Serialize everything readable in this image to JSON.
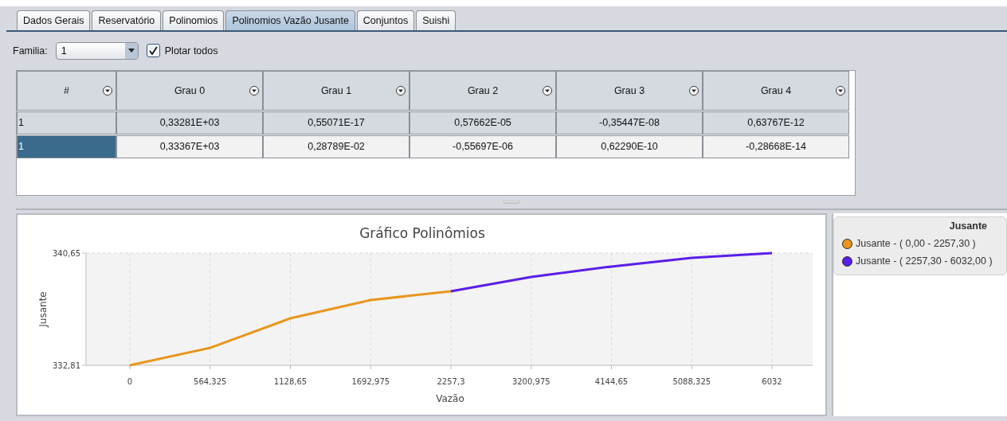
{
  "tabs": [
    {
      "label": "Dados Gerais",
      "selected": false
    },
    {
      "label": "Reservatório",
      "selected": false
    },
    {
      "label": "Polinomios",
      "selected": false
    },
    {
      "label": "Polinomios Vazão Jusante",
      "selected": true
    },
    {
      "label": "Conjuntos",
      "selected": false
    },
    {
      "label": "Suishi",
      "selected": false
    }
  ],
  "familia": {
    "label": "Familia:",
    "value": "1"
  },
  "plotar_todos": {
    "label": "Plotar todos",
    "checked": true
  },
  "table": {
    "columns": [
      "#",
      "Grau 0",
      "Grau 1",
      "Grau 2",
      "Grau 3",
      "Grau 4"
    ],
    "rows": [
      {
        "selected": false,
        "cells": [
          "1",
          "0,33281E+03",
          "0,55071E-17",
          "0,57662E-05",
          "-0,35447E-08",
          "0,63767E-12"
        ]
      },
      {
        "selected": true,
        "cells": [
          "1",
          "0,33367E+03",
          "0,28789E-02",
          "-0,55697E-06",
          "0,62290E-10",
          "-0,28668E-14"
        ]
      }
    ]
  },
  "chart": {
    "chart_data": {
      "type": "line",
      "title": "Gráfico Polinômios",
      "xlabel": "Vazão",
      "ylabel": "Jusante",
      "categories": [
        "0",
        "564,325",
        "1128,65",
        "1692,975",
        "2257,3",
        "3200,975",
        "4144,65",
        "5088,325",
        "6032"
      ],
      "series": [
        {
          "name": "Jusante - ( 0,00 - 2257,30 )",
          "color": "#e8961e",
          "values": [
            332.81,
            334.03,
            336.09,
            337.37,
            337.98,
            null,
            null,
            null,
            null
          ]
        },
        {
          "name": "Jusante - ( 2257,30 - 6032,00 )",
          "color": "#5b1ee8",
          "values": [
            null,
            null,
            null,
            null,
            337.98,
            338.98,
            339.71,
            340.32,
            340.65
          ]
        }
      ],
      "ylim": [
        332.81,
        340.65
      ],
      "grid": true,
      "yticks": [
        {
          "value": 332.81,
          "label": "332,81"
        },
        {
          "value": 340.65,
          "label": "340,65"
        }
      ]
    },
    "legend_title": "Jusante"
  }
}
